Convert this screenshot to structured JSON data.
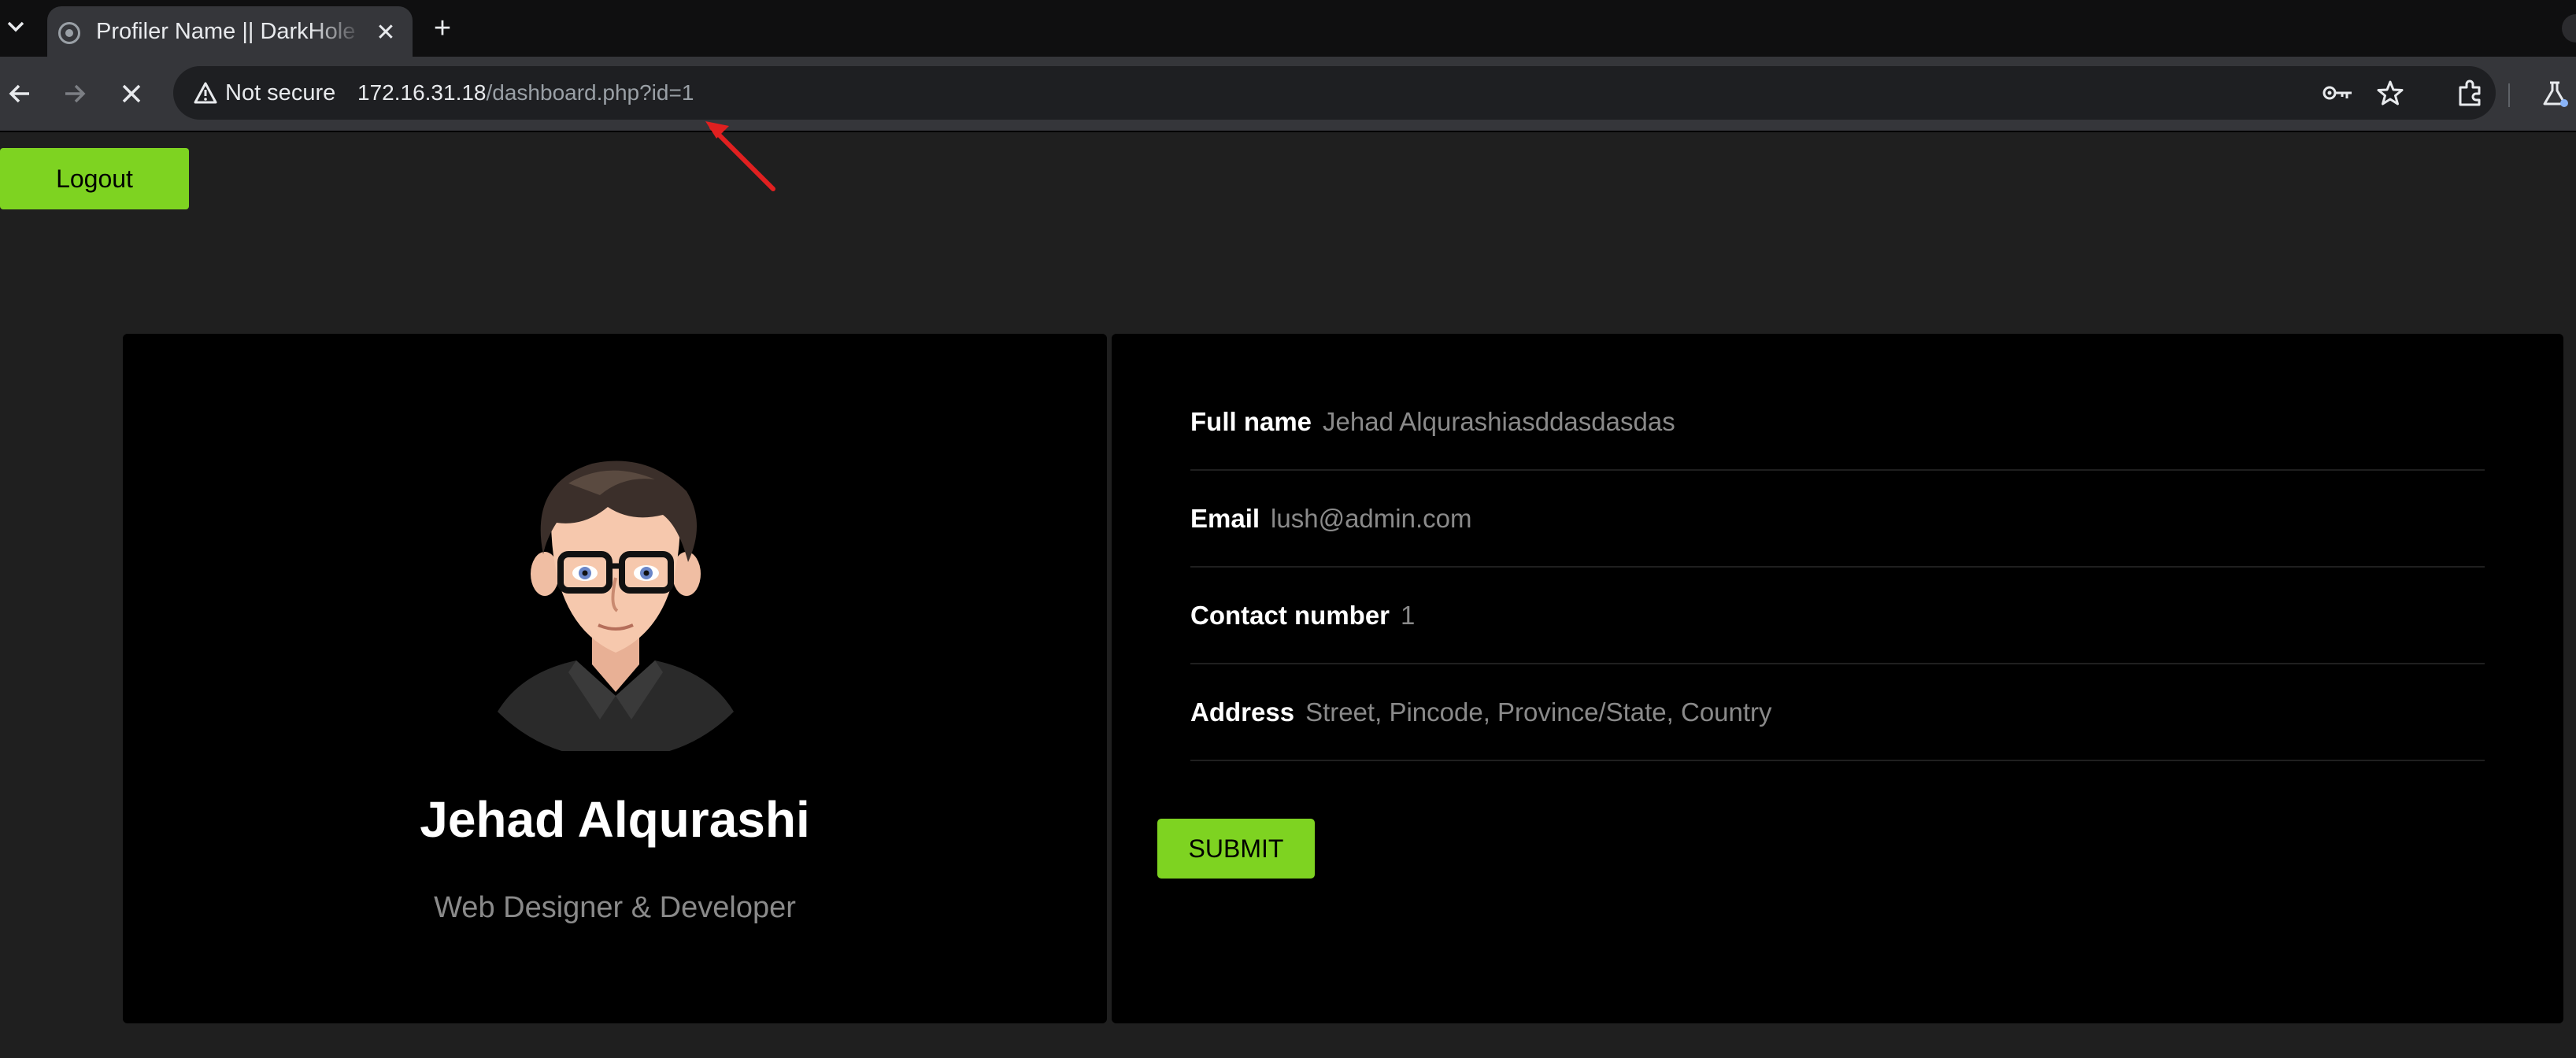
{
  "browser": {
    "tab_title": "Profiler Name || DarkHole",
    "security_label": "Not secure",
    "url_host": "172.16.31.18",
    "url_path": "/dashboard.php?id=1",
    "new_tab_symbol": "+",
    "close_symbol": "✕"
  },
  "page": {
    "logout_label": "Logout",
    "profile": {
      "name": "Jehad Alqurashi",
      "role": "Web Designer & Developer"
    },
    "fields": [
      {
        "label": "Full name",
        "value": "Jehad Alqurashiasddasdasdas"
      },
      {
        "label": "Email",
        "value": "lush@admin.com"
      },
      {
        "label": "Contact number",
        "value": "1"
      },
      {
        "label": "Address",
        "value": "Street, Pincode, Province/State, Country"
      }
    ],
    "submit_label": "SUBMIT"
  },
  "colors": {
    "accent_green": "#7ed321",
    "annotation_red": "#e02020"
  },
  "icons": [
    "chevron-down-icon",
    "favicon-icon",
    "close-icon",
    "plus-icon",
    "back-arrow-icon",
    "forward-arrow-icon",
    "stop-loading-icon",
    "warning-icon",
    "key-icon",
    "star-icon",
    "extensions-icon",
    "labs-flask-icon",
    "avatar-illustration"
  ]
}
